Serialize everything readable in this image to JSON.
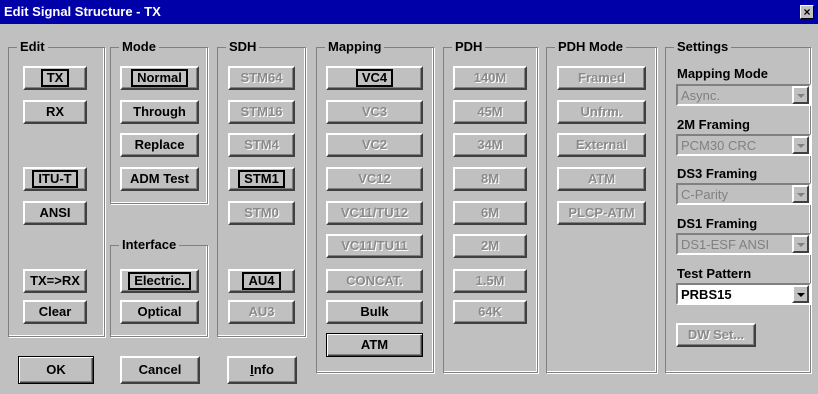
{
  "window": {
    "title": "Edit Signal Structure - TX",
    "close_glyph": "×"
  },
  "edit": {
    "label": "Edit",
    "tx": "TX",
    "rx": "RX",
    "itut": "ITU-T",
    "ansi": "ANSI",
    "txrx": "TX=>RX",
    "clear": "Clear"
  },
  "mode": {
    "label": "Mode",
    "normal": "Normal",
    "through": "Through",
    "replace": "Replace",
    "admtest": "ADM Test"
  },
  "interface": {
    "label": "Interface",
    "electric": "Electric.",
    "optical": "Optical"
  },
  "sdh": {
    "label": "SDH",
    "stm64": "STM64",
    "stm16": "STM16",
    "stm4": "STM4",
    "stm1": "STM1",
    "stm0": "STM0",
    "au4": "AU4",
    "au3": "AU3"
  },
  "mapping": {
    "label": "Mapping",
    "vc4": "VC4",
    "vc3": "VC3",
    "vc2": "VC2",
    "vc12": "VC12",
    "vc11tu12": "VC11/TU12",
    "vc11tu11": "VC11/TU11",
    "concat": "CONCAT.",
    "bulk": "Bulk",
    "atm": "ATM"
  },
  "pdh": {
    "label": "PDH",
    "r140m": "140M",
    "r45m": "45M",
    "r34m": "34M",
    "r8m": "8M",
    "r6m": "6M",
    "r2m": "2M",
    "r15m": "1.5M",
    "r64k": "64K"
  },
  "pdhmode": {
    "label": "PDH Mode",
    "framed": "Framed",
    "unfrm": "Unfrm.",
    "external": "External",
    "atm": "ATM",
    "plcp": "PLCP-ATM"
  },
  "settings": {
    "label": "Settings",
    "mapping_mode_label": "Mapping Mode",
    "mapping_mode_value": "Async.",
    "framing2m_label": "2M Framing",
    "framing2m_value": "PCM30 CRC",
    "ds3_label": "DS3 Framing",
    "ds3_value": "C-Parity",
    "ds1_label": "DS1 Framing",
    "ds1_value": "DS1-ESF ANSI",
    "test_pattern_label": "Test Pattern",
    "test_pattern_value": "PRBS15",
    "dwset": "DW Set..."
  },
  "footer": {
    "ok": "OK",
    "cancel": "Cancel",
    "info_prefix": "",
    "info_u": "I",
    "info_rest": "nfo"
  }
}
